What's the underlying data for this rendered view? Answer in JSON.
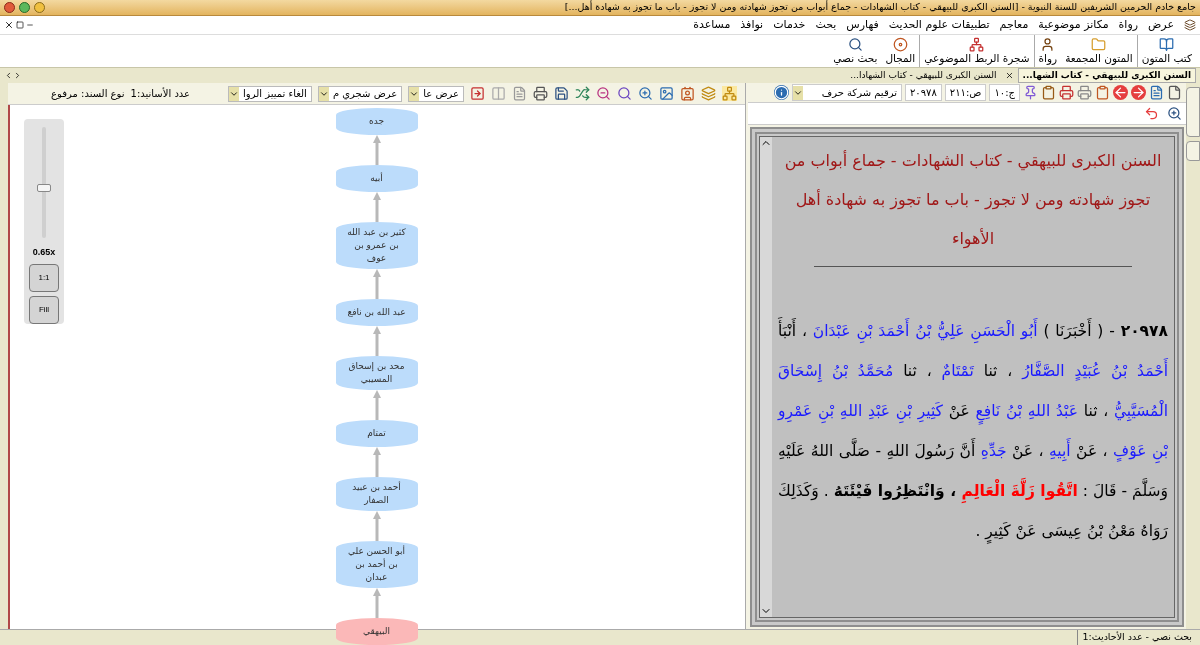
{
  "window": {
    "title": "جامع خادم الحرمين الشريفين للسنة النبوية - [السنن الكبرى للبيهقي - كتاب الشهادات - جماع أبواب من تجوز شهادته ومن لا تجوز - باب ما تجوز به شهادة أهل...]"
  },
  "menu": [
    "عرض",
    "رواة",
    "مكانز موضوعية",
    "معاجم",
    "تطبيقات علوم الحديث",
    "فهارس",
    "بحث",
    "خدمات",
    "نوافذ",
    "مساعدة"
  ],
  "toolbar": [
    {
      "label": "كتب المتون",
      "kind": "books"
    },
    {
      "label": "المتون المجمعة",
      "kind": "folder"
    },
    {
      "label": "رواة",
      "kind": "person"
    },
    {
      "label": "شجرة الربط الموضوعي",
      "kind": "tree"
    },
    {
      "label": "المجال",
      "kind": "target"
    },
    {
      "label": "بحث نصي",
      "kind": "search"
    }
  ],
  "tabs": [
    {
      "label": "السنن الكبرى للبيهقي - كتاب الشها...",
      "selected": true
    },
    {
      "label": "السنن الكبرى للبيهقي - كتاب الشهادا...",
      "selected": false
    }
  ],
  "chain_toolbar": {
    "dropdowns": [
      "عرض عا",
      "عرض شجري م",
      "الغاء تمييز الروا"
    ],
    "isnad_count": "عدد الأسانيد:1",
    "isnad_type": "نوع السند: مرفوع"
  },
  "zoom": {
    "level": 0.45,
    "reading": "0.65x",
    "buttons": [
      "1:1",
      "Fill"
    ]
  },
  "chain": [
    {
      "name": "جده",
      "kind": "narrator"
    },
    {
      "name": "أبيه",
      "kind": "narrator"
    },
    {
      "name": "كثير بن عبد الله بن عمرو بن عوف",
      "kind": "narrator"
    },
    {
      "name": "عبد الله بن نافع",
      "kind": "narrator"
    },
    {
      "name": "محد بن إسحاق المسيبي",
      "kind": "narrator"
    },
    {
      "name": "تمتام",
      "kind": "narrator"
    },
    {
      "name": "أحمد بن عبيد الصفار",
      "kind": "narrator"
    },
    {
      "name": "أبو الحسن علي بن أحمد بن عبدان",
      "kind": "narrator"
    },
    {
      "name": "البيهقي",
      "kind": "author"
    }
  ],
  "reader_toolbar": {
    "volume": "ج:١٠",
    "page": "ص:٢١١",
    "hadith_number": "٢٠٩٧٨",
    "numbering": "ترقيم شركة حرف"
  },
  "heading": "السنن الكبرى للبيهقي - كتاب الشهادات - جماع أبواب من تجوز شهادته ومن لا تجوز - باب ما تجوز به شهادة أهل الأهواء",
  "hadith": [
    {
      "text": "٢٠٩٧٨",
      "kind": "number"
    },
    {
      "text": " - ( أَخْبَرَنَا ) ",
      "kind": "plain"
    },
    {
      "text": "أَبُو الْحَسَنِ عَلِيُّ بْنُ أَحْمَدَ بْنِ عَبْدَانَ",
      "kind": "narrator"
    },
    {
      "text": " ، أَنْبَأَ ",
      "kind": "plain"
    },
    {
      "text": "أَحْمَدُ بْنُ عُبَيْدٍ الصَّفَّارُ",
      "kind": "narrator"
    },
    {
      "text": " ، ثنا ",
      "kind": "plain"
    },
    {
      "text": "تَمْتَامٌ",
      "kind": "narrator"
    },
    {
      "text": " ، ثنا ",
      "kind": "plain"
    },
    {
      "text": "مُحَمَّدُ بْنُ إِسْحَاقَ الْمُسَيَّبِيُّ",
      "kind": "narrator"
    },
    {
      "text": " ، ثنا ",
      "kind": "plain"
    },
    {
      "text": "عَبْدُ اللهِ بْنُ نَافِعٍ",
      "kind": "narrator"
    },
    {
      "text": " عَنْ ",
      "kind": "plain"
    },
    {
      "text": "كَثِيرِ بْنِ عَبْدِ اللهِ بْنِ عَمْرِو بْنِ عَوْفٍ",
      "kind": "narrator"
    },
    {
      "text": " ، عَنْ ",
      "kind": "plain"
    },
    {
      "text": "أَبِيهِ",
      "kind": "narrator"
    },
    {
      "text": " ، عَنْ ",
      "kind": "plain"
    },
    {
      "text": "جَدِّهِ",
      "kind": "narrator"
    },
    {
      "text": " أَنَّ رَسُولَ اللهِ - صَلَّى اللهُ عَلَيْهِ وَسَلَّمَ - قَالَ : ",
      "kind": "plain"
    },
    {
      "text": "اتَّقُوا زَلَّةَ الْعَالِمِ",
      "kind": "matn"
    },
    {
      "text": " ، وَانْتَظِرُوا فَيْئَتَهُ",
      "kind": "emphasis"
    },
    {
      "text": " . وَكَذَلِكَ رَوَاهُ مَعْنُ بْنُ عِيسَى عَنْ كَثِيرٍ .",
      "kind": "plain"
    }
  ],
  "status_bar": "بحث نصي - عدد الأحاديث:1"
}
